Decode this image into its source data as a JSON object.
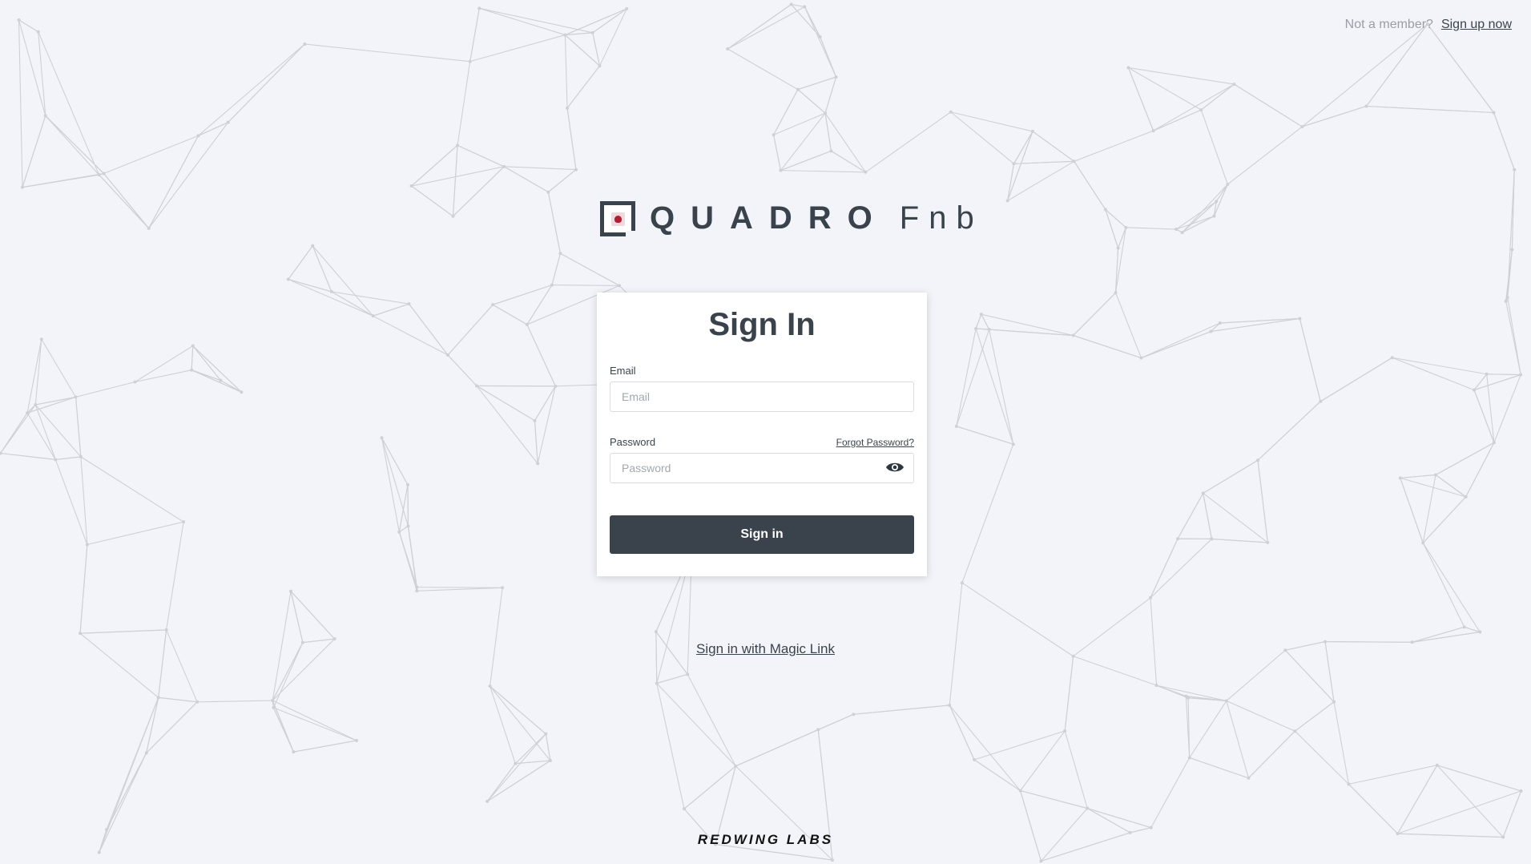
{
  "header": {
    "not_member_text": "Not a member?",
    "signup_link": "Sign up now"
  },
  "brand": {
    "name": "QUADRO",
    "suffix": "Fnb",
    "accent_color": "#b41e33",
    "primary_color": "#3a434b"
  },
  "form": {
    "title": "Sign In",
    "email_label": "Email",
    "email_placeholder": "Email",
    "email_value": "",
    "password_label": "Password",
    "password_placeholder": "Password",
    "password_value": "",
    "forgot_password": "Forgot Password?",
    "submit_label": "Sign in",
    "show_password_icon": "eye-icon"
  },
  "alt_login": {
    "magic_link": "Sign in with Magic Link"
  },
  "footer": {
    "brand": "REDWING LABS"
  }
}
